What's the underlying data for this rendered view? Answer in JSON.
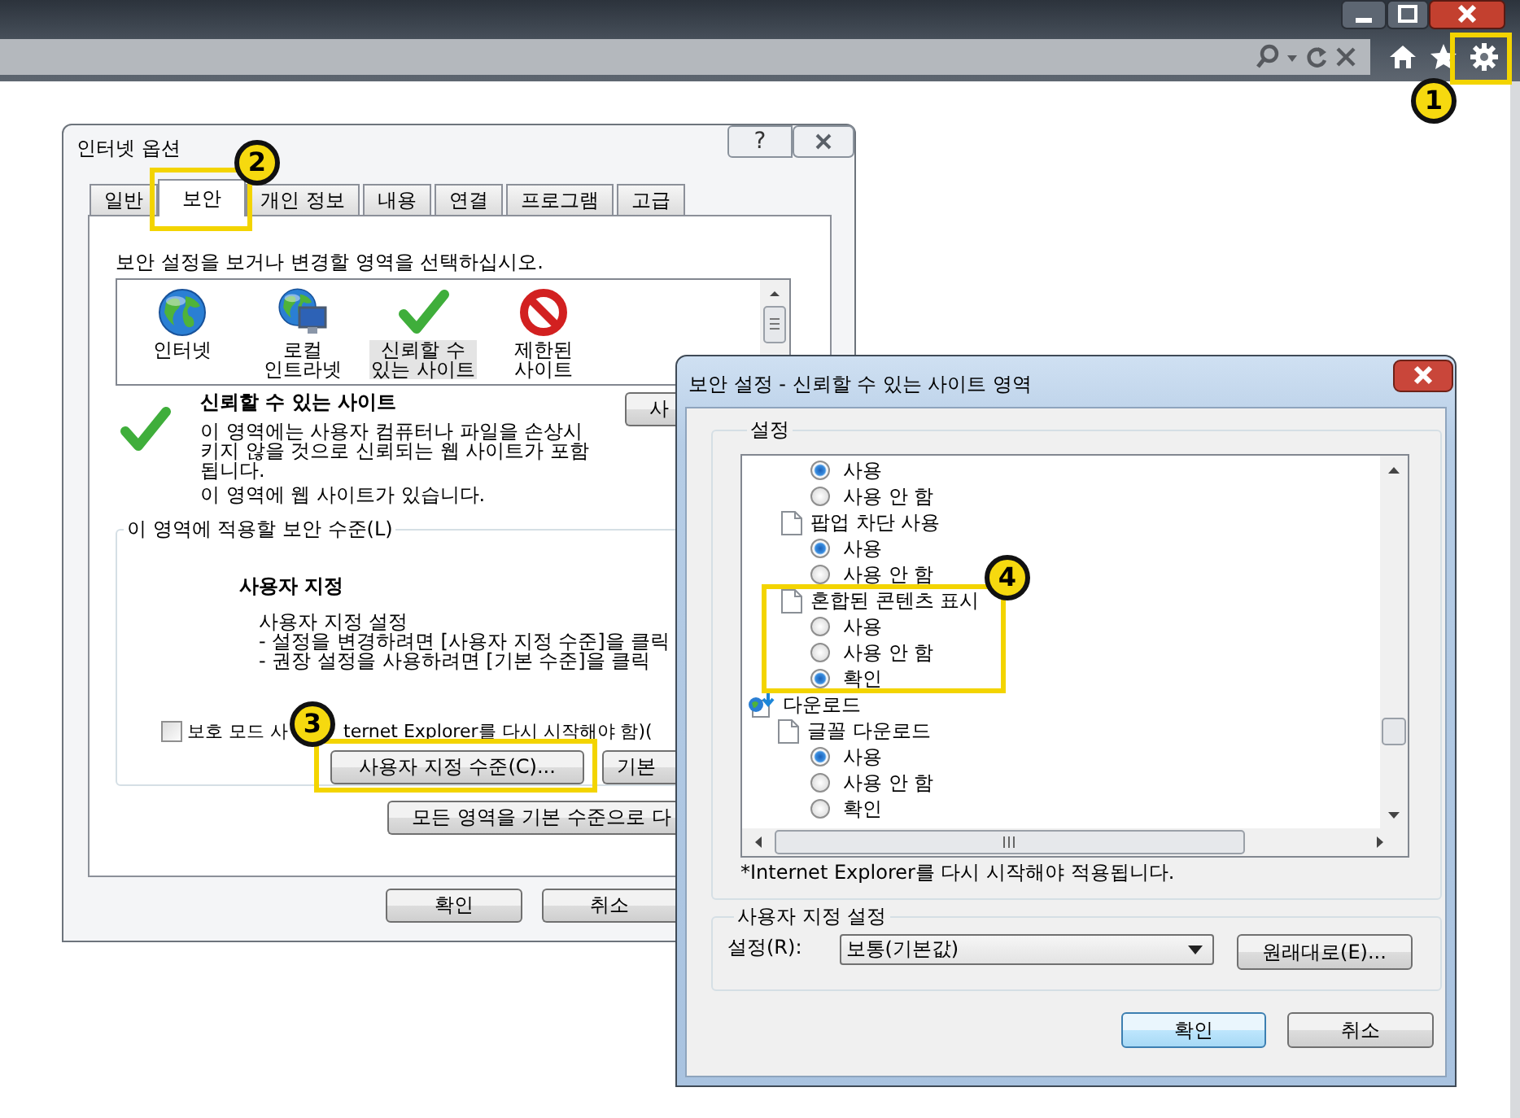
{
  "callouts": [
    {
      "number": "1"
    },
    {
      "number": "2"
    },
    {
      "number": "3"
    },
    {
      "number": "4"
    }
  ],
  "internet_options": {
    "title": "인터넷 옵션",
    "help_button": "?",
    "tabs": [
      {
        "label": "일반",
        "selected": false
      },
      {
        "label": "보안",
        "selected": true
      },
      {
        "label": "개인 정보",
        "selected": false
      },
      {
        "label": "내용",
        "selected": false
      },
      {
        "label": "연결",
        "selected": false
      },
      {
        "label": "프로그램",
        "selected": false
      },
      {
        "label": "고급",
        "selected": false
      }
    ],
    "zone_prompt": "보안 설정을 보거나 변경할 영역을 선택하십시오.",
    "zones": [
      {
        "label": "인터넷",
        "kind": "internet",
        "selected": false
      },
      {
        "label": "로컬 인트라넷",
        "kind": "intranet",
        "selected": false
      },
      {
        "label": "신뢰할 수 있는 사이트",
        "kind": "trusted",
        "selected": true
      },
      {
        "label": "제한된 사이트",
        "kind": "restricted",
        "selected": false
      }
    ],
    "zone_title": "신뢰할 수 있는 사이트",
    "zone_description": "이 영역에는 사용자 컴퓨터나 파일을 손상시키지 않을 것으로 신뢰되는 웹 사이트가 포함됩니다.",
    "zone_status": "이 영역에 웹 사이트가 있습니다.",
    "sites_button": "사",
    "level_group": "이 영역에 적용할 보안 수준(L)",
    "level_name": "사용자 지정",
    "level_lines": [
      "사용자 지정 설정",
      "- 설정을 변경하려면 [사용자 지정 수준]을 클릭",
      "- 권장 설정을 사용하려면 [기본 수준]을 클릭"
    ],
    "protected_mode": {
      "checked": false,
      "label_start": "보호 모드 사",
      "label_end": "ternet Explorer를 다시 시작해야 함)("
    },
    "custom_level_button": "사용자 지정 수준(C)...",
    "default_level_button": "기본",
    "reset_all_button": "모든 영역을 기본 수준으로 다",
    "ok_button": "확인",
    "cancel_button": "취소"
  },
  "security_settings": {
    "title": "보안 설정 - 신뢰할 수 있는 사이트 영역",
    "group": "설정",
    "tree": [
      {
        "kind": "option",
        "label": "사용",
        "selected": true
      },
      {
        "kind": "option",
        "label": "사용 안 함",
        "selected": false
      },
      {
        "kind": "setting",
        "label": "팝업 차단 사용",
        "children": [
          {
            "kind": "option",
            "label": "사용",
            "selected": true
          },
          {
            "kind": "option",
            "label": "사용 안 함",
            "selected": false
          }
        ]
      },
      {
        "kind": "setting",
        "label": "혼합된 콘텐츠 표시",
        "children": [
          {
            "kind": "option",
            "label": "사용",
            "selected": false
          },
          {
            "kind": "option",
            "label": "사용 안 함",
            "selected": false
          },
          {
            "kind": "option",
            "label": "확인",
            "selected": true
          }
        ]
      },
      {
        "kind": "category",
        "label": "다운로드",
        "children": [
          {
            "kind": "setting",
            "label": "글꼴 다운로드",
            "children": [
              {
                "kind": "option",
                "label": "사용",
                "selected": true
              },
              {
                "kind": "option",
                "label": "사용 안 함",
                "selected": false
              },
              {
                "kind": "option",
                "label": "확인",
                "selected": false
              }
            ]
          }
        ]
      }
    ],
    "restart_note": "*Internet Explorer를 다시 시작해야 적용됩니다.",
    "custom_group": "사용자 지정 설정",
    "setting_label": "설정(R):",
    "setting_value": "보통(기본값)",
    "reset_button": "원래대로(E)...",
    "ok_button": "확인",
    "cancel_button": "취소"
  }
}
